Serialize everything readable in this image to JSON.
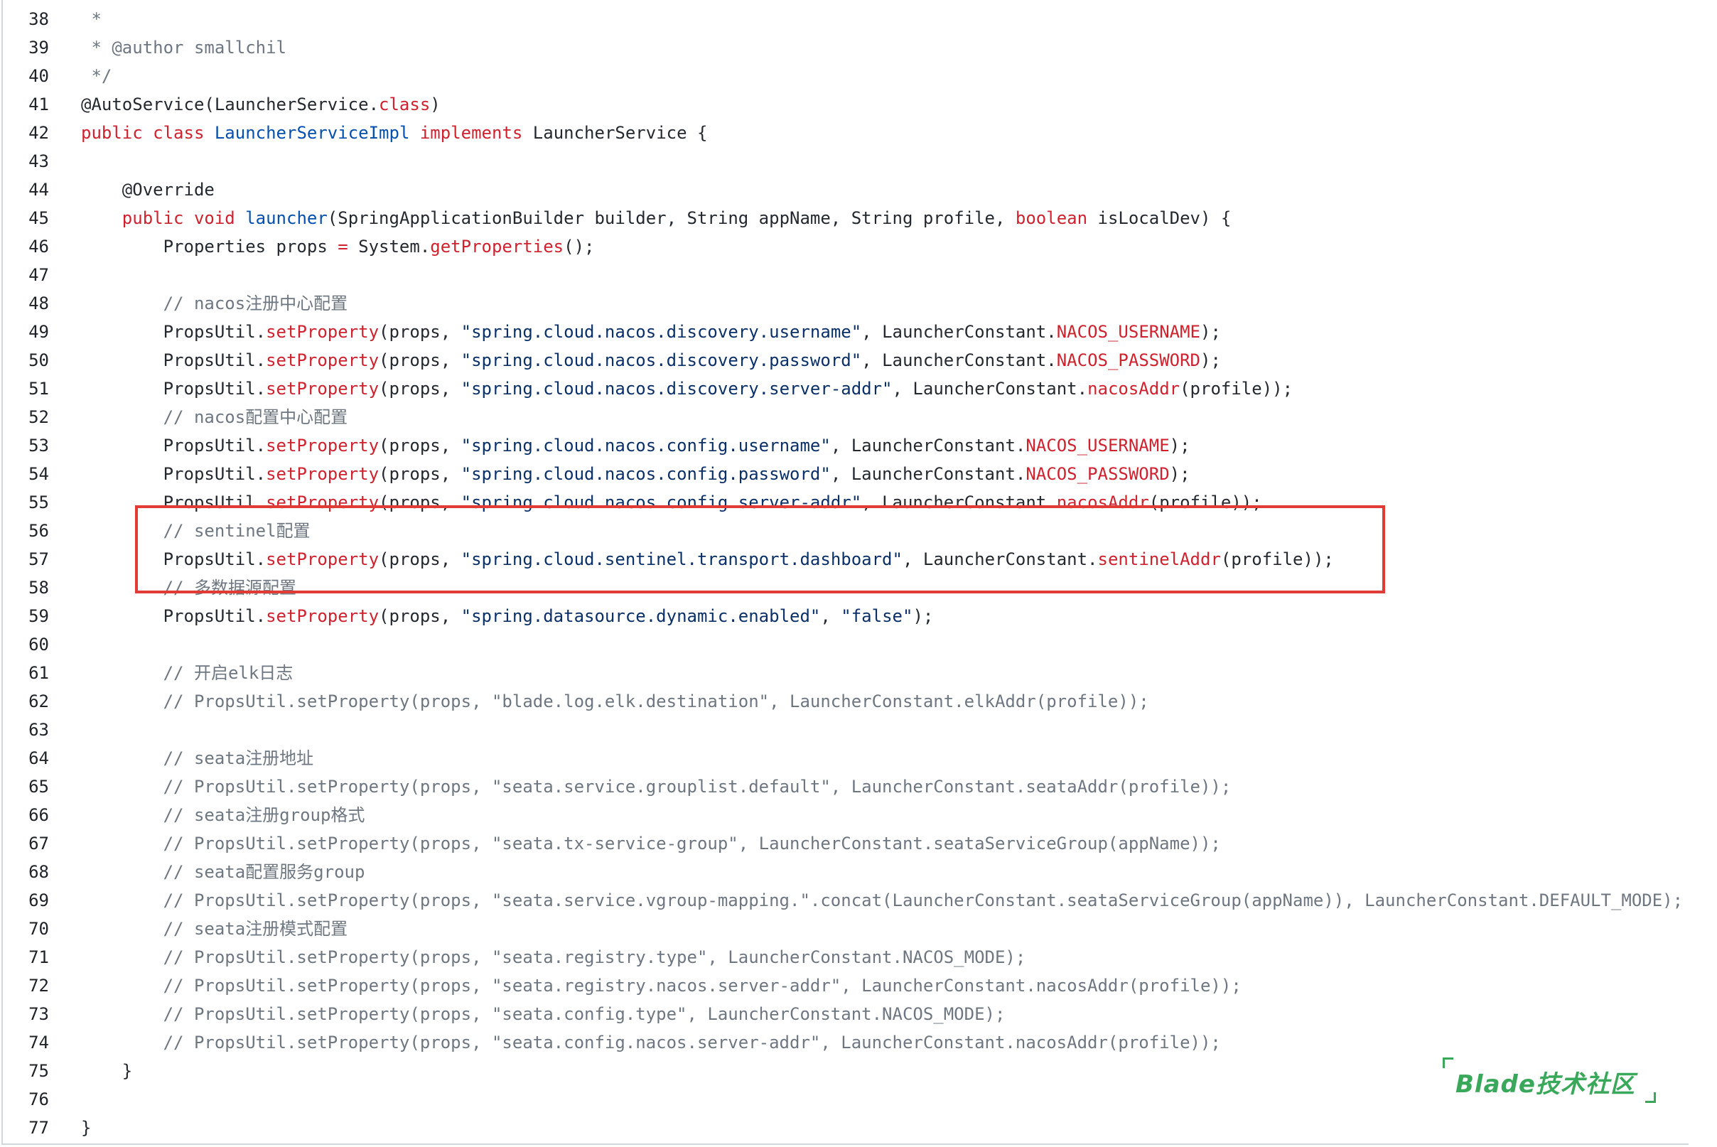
{
  "code": {
    "lines": [
      {
        "n": "38",
        "text": " *"
      },
      {
        "n": "39",
        "text": " * @author smallchil"
      },
      {
        "n": "40",
        "text": " */"
      },
      {
        "n": "41",
        "text": "@AutoService(LauncherService.class)"
      },
      {
        "n": "42",
        "text": "public class LauncherServiceImpl implements LauncherService {"
      },
      {
        "n": "43",
        "text": ""
      },
      {
        "n": "44",
        "text": "    @Override"
      },
      {
        "n": "45",
        "text": "    public void launcher(SpringApplicationBuilder builder, String appName, String profile, boolean isLocalDev) {"
      },
      {
        "n": "46",
        "text": "        Properties props = System.getProperties();"
      },
      {
        "n": "47",
        "text": ""
      },
      {
        "n": "48",
        "text": "        // nacos注册中心配置"
      },
      {
        "n": "49",
        "text": "        PropsUtil.setProperty(props, \"spring.cloud.nacos.discovery.username\", LauncherConstant.NACOS_USERNAME);"
      },
      {
        "n": "50",
        "text": "        PropsUtil.setProperty(props, \"spring.cloud.nacos.discovery.password\", LauncherConstant.NACOS_PASSWORD);"
      },
      {
        "n": "51",
        "text": "        PropsUtil.setProperty(props, \"spring.cloud.nacos.discovery.server-addr\", LauncherConstant.nacosAddr(profile));"
      },
      {
        "n": "52",
        "text": "        // nacos配置中心配置"
      },
      {
        "n": "53",
        "text": "        PropsUtil.setProperty(props, \"spring.cloud.nacos.config.username\", LauncherConstant.NACOS_USERNAME);"
      },
      {
        "n": "54",
        "text": "        PropsUtil.setProperty(props, \"spring.cloud.nacos.config.password\", LauncherConstant.NACOS_PASSWORD);"
      },
      {
        "n": "55",
        "text": "        PropsUtil.setProperty(props, \"spring.cloud.nacos.config.server-addr\", LauncherConstant.nacosAddr(profile));"
      },
      {
        "n": "56",
        "text": "        // sentinel配置"
      },
      {
        "n": "57",
        "text": "        PropsUtil.setProperty(props, \"spring.cloud.sentinel.transport.dashboard\", LauncherConstant.sentinelAddr(profile));"
      },
      {
        "n": "58",
        "text": "        // 多数据源配置"
      },
      {
        "n": "59",
        "text": "        PropsUtil.setProperty(props, \"spring.datasource.dynamic.enabled\", \"false\");"
      },
      {
        "n": "60",
        "text": ""
      },
      {
        "n": "61",
        "text": "        // 开启elk日志"
      },
      {
        "n": "62",
        "text": "        // PropsUtil.setProperty(props, \"blade.log.elk.destination\", LauncherConstant.elkAddr(profile));"
      },
      {
        "n": "63",
        "text": ""
      },
      {
        "n": "64",
        "text": "        // seata注册地址"
      },
      {
        "n": "65",
        "text": "        // PropsUtil.setProperty(props, \"seata.service.grouplist.default\", LauncherConstant.seataAddr(profile));"
      },
      {
        "n": "66",
        "text": "        // seata注册group格式"
      },
      {
        "n": "67",
        "text": "        // PropsUtil.setProperty(props, \"seata.tx-service-group\", LauncherConstant.seataServiceGroup(appName));"
      },
      {
        "n": "68",
        "text": "        // seata配置服务group"
      },
      {
        "n": "69",
        "text": "        // PropsUtil.setProperty(props, \"seata.service.vgroup-mapping.\".concat(LauncherConstant.seataServiceGroup(appName)), LauncherConstant.DEFAULT_MODE);"
      },
      {
        "n": "70",
        "text": "        // seata注册模式配置"
      },
      {
        "n": "71",
        "text": "        // PropsUtil.setProperty(props, \"seata.registry.type\", LauncherConstant.NACOS_MODE);"
      },
      {
        "n": "72",
        "text": "        // PropsUtil.setProperty(props, \"seata.registry.nacos.server-addr\", LauncherConstant.nacosAddr(profile));"
      },
      {
        "n": "73",
        "text": "        // PropsUtil.setProperty(props, \"seata.config.type\", LauncherConstant.NACOS_MODE);"
      },
      {
        "n": "74",
        "text": "        // PropsUtil.setProperty(props, \"seata.config.nacos.server-addr\", LauncherConstant.nacosAddr(profile));"
      },
      {
        "n": "75",
        "text": "    }"
      },
      {
        "n": "76",
        "text": ""
      },
      {
        "n": "77",
        "text": "}"
      }
    ]
  },
  "watermark": {
    "text": "Blade技术社区"
  },
  "colors": {
    "keyword": "#cf222e",
    "string": "#0a3069",
    "comment": "#6e7781",
    "type": "#0550ae",
    "highlight_border": "#e03c35",
    "watermark": "#3aa85a"
  }
}
